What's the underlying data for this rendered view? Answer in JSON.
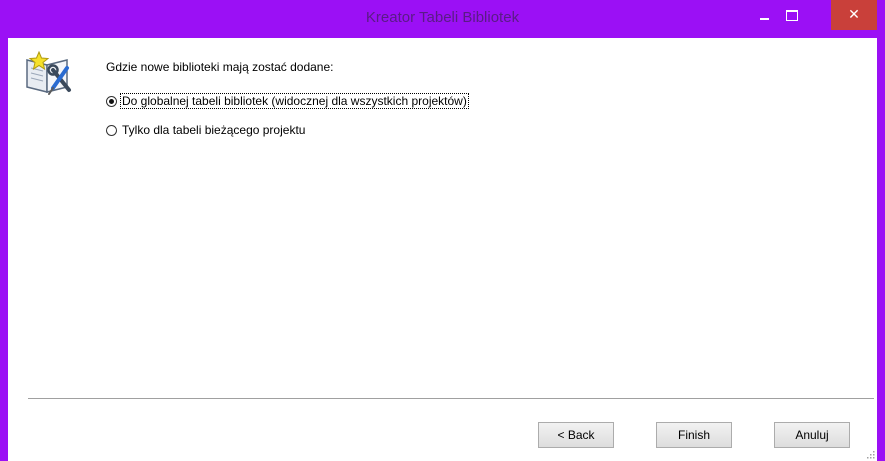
{
  "window": {
    "title": "Kreator Tabeli Bibliotek",
    "close_glyph": "✕",
    "accent_color": "#9b10f5",
    "close_color": "#c9403a"
  },
  "content": {
    "icon": "wizard-book-tools-icon",
    "question": "Gdzie nowe biblioteki mają zostać dodane:",
    "options": [
      {
        "label": "Do globalnej tabeli bibliotek (widocznej dla wszystkich projektów)",
        "checked": true
      },
      {
        "label": "Tylko dla tabeli bieżącego projektu",
        "checked": false
      }
    ]
  },
  "buttons": {
    "back": "< Back",
    "finish": "Finish",
    "cancel": "Anuluj"
  }
}
